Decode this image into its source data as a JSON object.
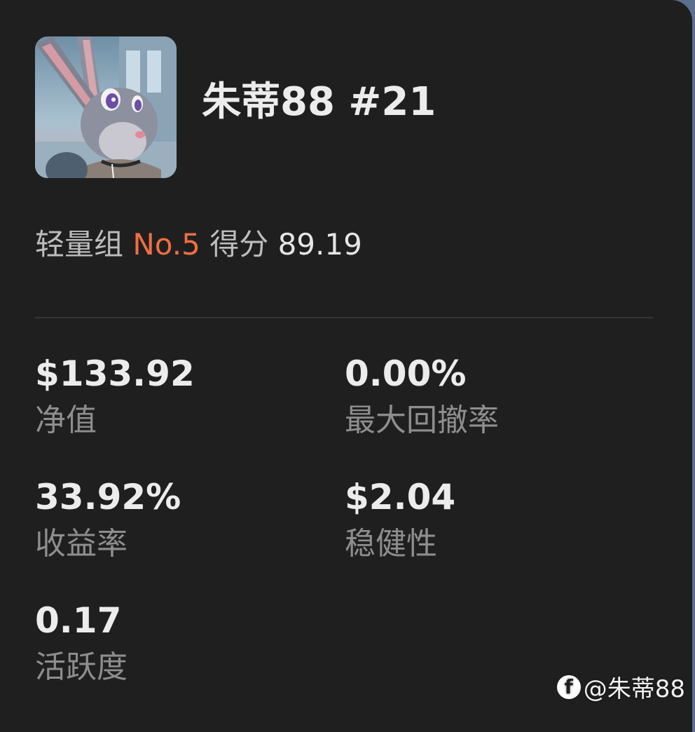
{
  "player": {
    "name": "朱蒂88 #21"
  },
  "rank": {
    "group": "轻量组",
    "number": "No.5",
    "score_label": "得分",
    "score": "89.19"
  },
  "stats": {
    "net_value": {
      "value": "$133.92",
      "label": "净值"
    },
    "max_drawdown": {
      "value": "0.00%",
      "label": "最大回撤率"
    },
    "return_rate": {
      "value": "33.92%",
      "label": "收益率"
    },
    "stability": {
      "value": "$2.04",
      "label": "稳健性"
    },
    "activity": {
      "value": "0.17",
      "label": "活跃度"
    }
  },
  "watermark": {
    "icon": "f",
    "text": "@朱蒂88"
  },
  "colors": {
    "card_background": "#1f1f1f",
    "rank_accent": "#ef6f43",
    "label_gray": "#8e8e8e",
    "value_white": "#ececec"
  }
}
